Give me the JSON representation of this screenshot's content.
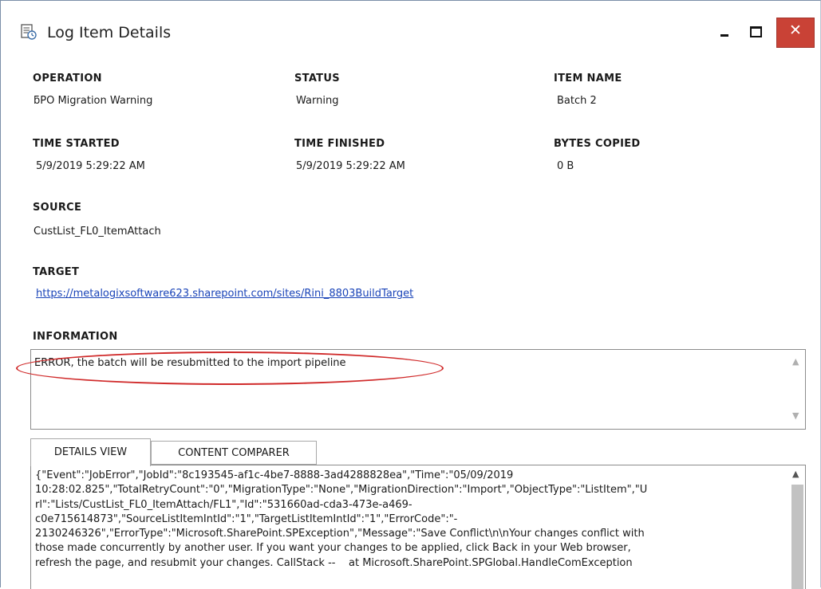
{
  "window": {
    "title": "Log Item Details",
    "icon": "log-item-icon",
    "buttons": {
      "minimize": "minimize-icon",
      "maximize": "maximize-icon",
      "close_glyph": "✕"
    },
    "accent": "#c94236"
  },
  "fields": {
    "operation": {
      "label": "OPERATION",
      "value": "ƃPO Migration Warning"
    },
    "status": {
      "label": "STATUS",
      "value": "Warning"
    },
    "item_name": {
      "label": "ITEM NAME",
      "value": "Batch 2"
    },
    "time_started": {
      "label": "TIME STARTED",
      "value": "5/9/2019 5:29:22 AM"
    },
    "time_finished": {
      "label": "TIME FINISHED",
      "value": "5/9/2019 5:29:22 AM"
    },
    "bytes_copied": {
      "label": "BYTES COPIED",
      "value": "0 B"
    },
    "source": {
      "label": "SOURCE",
      "value": "CustList_FL0_ItemAttach"
    },
    "target": {
      "label": "TARGET",
      "value": "https://metalogixsoftware623.sharepoint.com/sites/Rini_8803BuildTarget"
    },
    "information": {
      "label": "INFORMATION",
      "value": "ERROR, the batch will be resubmitted to the import pipeline"
    }
  },
  "tabs": [
    {
      "label": "DETAILS VIEW",
      "active": true
    },
    {
      "label": "CONTENT COMPARER",
      "active": false
    }
  ],
  "details": {
    "text": "{\"Event\":\"JobError\",\"JobId\":\"8c193545-af1c-4be7-8888-3ad4288828ea\",\"Time\":\"05/09/2019\n10:28:02.825\",\"TotalRetryCount\":\"0\",\"MigrationType\":\"None\",\"MigrationDirection\":\"Import\",\"ObjectType\":\"ListItem\",\"U\nrl\":\"Lists/CustList_FL0_ItemAttach/FL1\",\"Id\":\"531660ad-cda3-473e-a469-\nc0e715614873\",\"SourceListItemIntId\":\"1\",\"TargetListItemIntId\":\"1\",\"ErrorCode\":\"-\n2130246326\",\"ErrorType\":\"Microsoft.SharePoint.SPException\",\"Message\":\"Save Conflict\\n\\nYour changes conflict with\nthose made concurrently by another user. If you want your changes to be applied, click Back in your Web browser,\nrefresh the page, and resubmit your changes. CallStack --    at Microsoft.SharePoint.SPGlobal.HandleComException"
  },
  "colors": {
    "link": "#1a44b8",
    "highlight": "#d02a2a"
  }
}
